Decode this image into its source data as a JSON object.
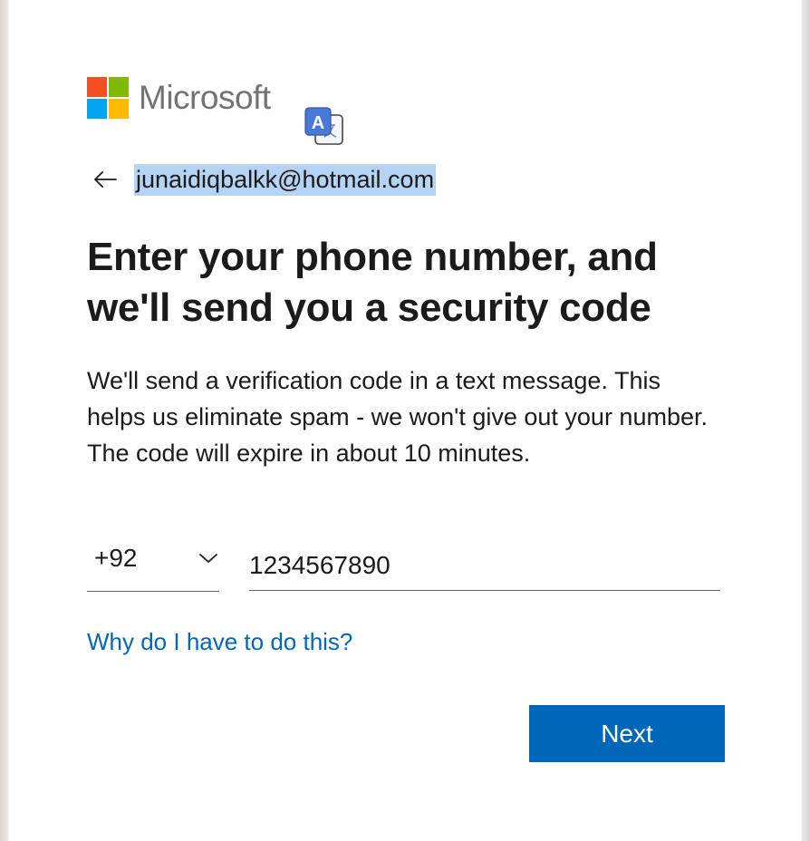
{
  "brand": {
    "name": "Microsoft",
    "colors": {
      "red": "#f25022",
      "green": "#7fba00",
      "blue": "#00a4ef",
      "yellow": "#ffb900",
      "text": "#737373"
    }
  },
  "identity": {
    "back_icon": "back-arrow-icon",
    "email": "junaidiqbalkk@hotmail.com"
  },
  "translate_icon": "translate-icon",
  "title": "Enter your phone number, and we'll send you a security code",
  "description": "We'll send a verification code in a text message. This helps us eliminate spam - we won't give out your number. The code will expire in about 10 minutes.",
  "phone": {
    "country_code": "+92",
    "number": "1234567890"
  },
  "help_link": "Why do I have to do this?",
  "next_button": "Next",
  "accent_color": "#0067b8"
}
